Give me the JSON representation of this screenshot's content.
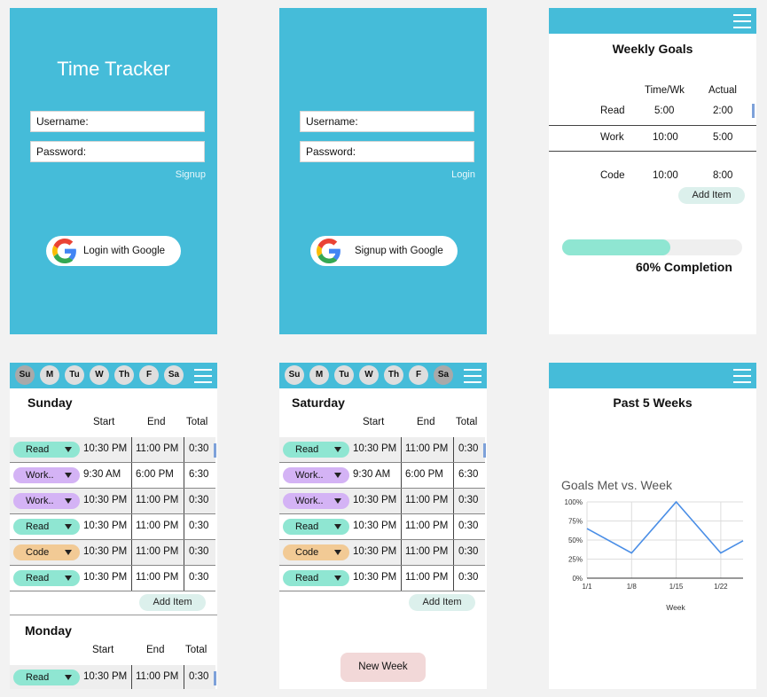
{
  "colors": {
    "brand": "#45bcd9",
    "read": "#8fe6d2",
    "work": "#d4b3f5",
    "code": "#f2ca95",
    "progress": "#8fe6d2",
    "new_week": "#f2d8d8"
  },
  "login_screen": {
    "title": "Time Tracker",
    "username_label": "Username:",
    "password_label": "Password:",
    "secondary_link": "Signup",
    "google_button": "Login with Google"
  },
  "signup_screen": {
    "username_label": "Username:",
    "password_label": "Password:",
    "secondary_link": "Login",
    "google_button": "Signup with Google"
  },
  "goals_screen": {
    "title": "Weekly Goals",
    "col_time": "Time/Wk",
    "col_actual": "Actual",
    "rows": [
      {
        "name": "Read",
        "time": "5:00",
        "actual": "2:00"
      },
      {
        "name": "Work",
        "time": "10:00",
        "actual": "5:00"
      },
      {
        "name": "Code",
        "time": "10:00",
        "actual": "8:00"
      }
    ],
    "add_item": "Add Item",
    "progress_fraction": 0.6,
    "completion_label": "60% Completion"
  },
  "days": [
    "Su",
    "M",
    "Tu",
    "W",
    "Th",
    "F",
    "Sa"
  ],
  "columns": {
    "start": "Start",
    "end": "End",
    "total": "Total"
  },
  "sunday_screen": {
    "section1": "Sunday",
    "rows": [
      {
        "tag": "Read",
        "start": "10:30 PM",
        "end": "11:00 PM",
        "total": "0:30"
      },
      {
        "tag": "Work..",
        "start": "9:30 AM",
        "end": "6:00 PM",
        "total": "6:30"
      },
      {
        "tag": "Work..",
        "start": "10:30 PM",
        "end": "11:00 PM",
        "total": "0:30"
      },
      {
        "tag": "Read",
        "start": "10:30 PM",
        "end": "11:00 PM",
        "total": "0:30"
      },
      {
        "tag": "Code",
        "start": "10:30 PM",
        "end": "11:00 PM",
        "total": "0:30"
      },
      {
        "tag": "Read",
        "start": "10:30 PM",
        "end": "11:00 PM",
        "total": "0:30"
      }
    ],
    "add_item": "Add Item",
    "section2": "Monday",
    "monday_rows": [
      {
        "tag": "Read",
        "start": "10:30 PM",
        "end": "11:00 PM",
        "total": "0:30"
      }
    ]
  },
  "saturday_screen": {
    "section1": "Saturday",
    "rows": [
      {
        "tag": "Read",
        "start": "10:30 PM",
        "end": "11:00 PM",
        "total": "0:30"
      },
      {
        "tag": "Work..",
        "start": "9:30 AM",
        "end": "6:00 PM",
        "total": "6:30"
      },
      {
        "tag": "Work..",
        "start": "10:30 PM",
        "end": "11:00 PM",
        "total": "0:30"
      },
      {
        "tag": "Read",
        "start": "10:30 PM",
        "end": "11:00 PM",
        "total": "0:30"
      },
      {
        "tag": "Code",
        "start": "10:30 PM",
        "end": "11:00 PM",
        "total": "0:30"
      },
      {
        "tag": "Read",
        "start": "10:30 PM",
        "end": "11:00 PM",
        "total": "0:30"
      }
    ],
    "add_item": "Add Item",
    "new_week": "New Week"
  },
  "history_screen": {
    "title": "Past 5 Weeks"
  },
  "chart_data": {
    "type": "line",
    "title": "Goals Met vs. Week",
    "xlabel": "Week",
    "ylabel": "",
    "x_ticks": [
      "1/1",
      "1/8",
      "1/15",
      "1/22"
    ],
    "y_ticks": [
      "0%",
      "25%",
      "50%",
      "75%",
      "100%"
    ],
    "ylim": [
      0,
      100
    ],
    "grid": true,
    "series": [
      {
        "x": [
          0,
          1,
          2,
          3,
          3.5
        ],
        "values": [
          65,
          33,
          100,
          33,
          49
        ]
      }
    ]
  }
}
